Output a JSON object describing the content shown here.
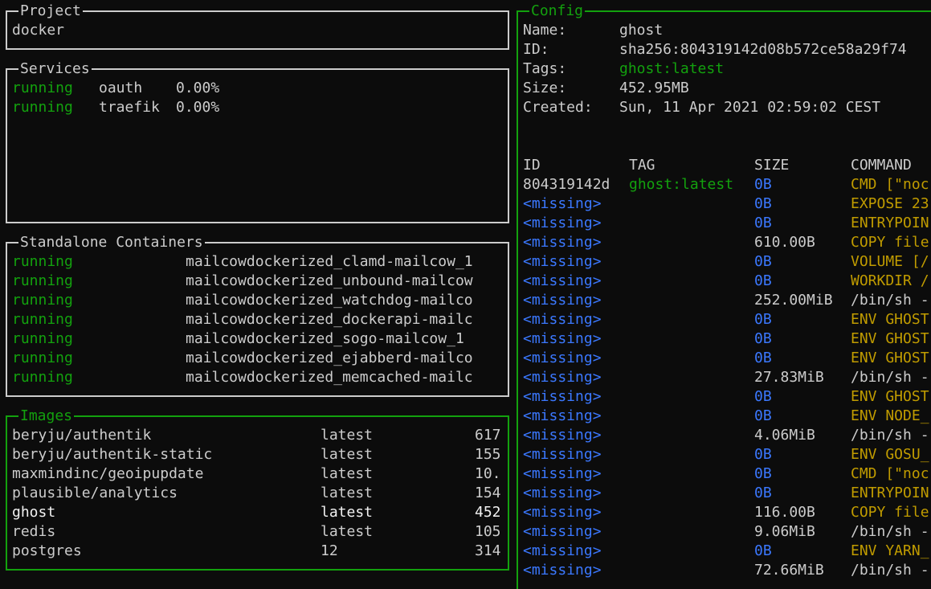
{
  "colors": {
    "border": "#cccccc",
    "active_border": "#13a10e",
    "running": "#13a10e",
    "missing": "#3b78ff",
    "command": "#c19c00",
    "tag": "#13a10e"
  },
  "project": {
    "title": "Project",
    "name": "docker"
  },
  "services": {
    "title": "Services",
    "items": [
      {
        "status": "running",
        "name": "oauth",
        "cpu": "0.00%"
      },
      {
        "status": "running",
        "name": "traefik",
        "cpu": "0.00%"
      }
    ]
  },
  "containers": {
    "title": "Standalone Containers",
    "items": [
      {
        "status": "running",
        "name": "mailcowdockerized_clamd-mailcow_1"
      },
      {
        "status": "running",
        "name": "mailcowdockerized_unbound-mailcow"
      },
      {
        "status": "running",
        "name": "mailcowdockerized_watchdog-mailco"
      },
      {
        "status": "running",
        "name": "mailcowdockerized_dockerapi-mailc"
      },
      {
        "status": "running",
        "name": "mailcowdockerized_sogo-mailcow_1"
      },
      {
        "status": "running",
        "name": "mailcowdockerized_ejabberd-mailco"
      },
      {
        "status": "running",
        "name": "mailcowdockerized_memcached-mailc"
      }
    ]
  },
  "images": {
    "title": "Images",
    "items": [
      {
        "name": "beryju/authentik",
        "tag": "latest",
        "size": "617"
      },
      {
        "name": "beryju/authentik-static",
        "tag": "latest",
        "size": "155"
      },
      {
        "name": "maxmindinc/geoipupdate",
        "tag": "latest",
        "size": "10."
      },
      {
        "name": "plausible/analytics",
        "tag": "latest",
        "size": "154"
      },
      {
        "name": "ghost",
        "tag": "latest",
        "size": "452"
      },
      {
        "name": "redis",
        "tag": "latest",
        "size": "105"
      },
      {
        "name": "postgres",
        "tag": "12",
        "size": "314"
      }
    ]
  },
  "config": {
    "title": "Config",
    "fields": [
      {
        "label": "Name:",
        "value": "ghost"
      },
      {
        "label": "ID:",
        "value": "sha256:804319142d08b572ce58a29f74"
      },
      {
        "label": "Tags:",
        "value": "ghost:latest"
      },
      {
        "label": "Size:",
        "value": "452.95MB"
      },
      {
        "label": "Created:",
        "value": "Sun, 11 Apr 2021 02:59:02 CEST"
      }
    ],
    "history_headers": {
      "id": "ID",
      "tag": "TAG",
      "size": "SIZE",
      "command": "COMMAND"
    },
    "history": [
      {
        "id": "804319142d",
        "tag": "ghost:latest",
        "size": "0B",
        "command": "CMD [\"noc"
      },
      {
        "id": "<missing>",
        "tag": "",
        "size": "0B",
        "command": "EXPOSE 23"
      },
      {
        "id": "<missing>",
        "tag": "",
        "size": "0B",
        "command": "ENTRYPOIN"
      },
      {
        "id": "<missing>",
        "tag": "",
        "size": "610.00B",
        "command": "COPY file"
      },
      {
        "id": "<missing>",
        "tag": "",
        "size": "0B",
        "command": "VOLUME [/"
      },
      {
        "id": "<missing>",
        "tag": "",
        "size": "0B",
        "command": "WORKDIR /"
      },
      {
        "id": "<missing>",
        "tag": "",
        "size": "252.00MiB",
        "command": "/bin/sh -"
      },
      {
        "id": "<missing>",
        "tag": "",
        "size": "0B",
        "command": "ENV GHOST"
      },
      {
        "id": "<missing>",
        "tag": "",
        "size": "0B",
        "command": "ENV GHOST"
      },
      {
        "id": "<missing>",
        "tag": "",
        "size": "0B",
        "command": "ENV GHOST"
      },
      {
        "id": "<missing>",
        "tag": "",
        "size": "27.83MiB",
        "command": "/bin/sh -"
      },
      {
        "id": "<missing>",
        "tag": "",
        "size": "0B",
        "command": "ENV GHOST"
      },
      {
        "id": "<missing>",
        "tag": "",
        "size": "0B",
        "command": "ENV NODE_"
      },
      {
        "id": "<missing>",
        "tag": "",
        "size": "4.06MiB",
        "command": "/bin/sh -"
      },
      {
        "id": "<missing>",
        "tag": "",
        "size": "0B",
        "command": "ENV GOSU_"
      },
      {
        "id": "<missing>",
        "tag": "",
        "size": "0B",
        "command": "CMD [\"noc"
      },
      {
        "id": "<missing>",
        "tag": "",
        "size": "0B",
        "command": "ENTRYPOIN"
      },
      {
        "id": "<missing>",
        "tag": "",
        "size": "116.00B",
        "command": "COPY file"
      },
      {
        "id": "<missing>",
        "tag": "",
        "size": "9.06MiB",
        "command": "/bin/sh -"
      },
      {
        "id": "<missing>",
        "tag": "",
        "size": "0B",
        "command": "ENV YARN_"
      },
      {
        "id": "<missing>",
        "tag": "",
        "size": "72.66MiB",
        "command": "/bin/sh -"
      }
    ]
  }
}
